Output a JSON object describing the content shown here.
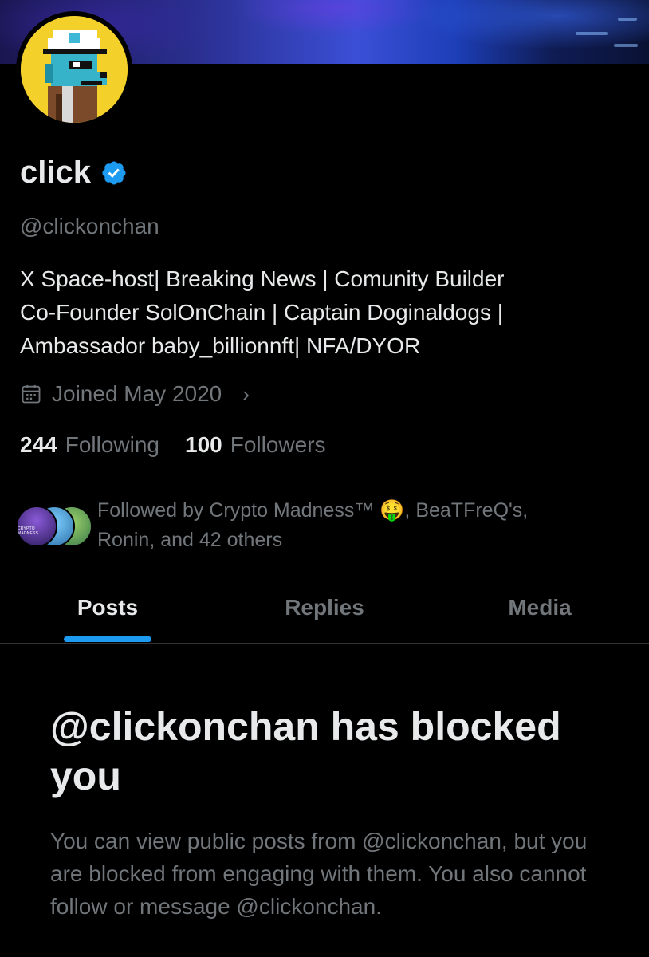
{
  "profile": {
    "display_name": "click",
    "handle": "@clickonchan",
    "bio_lines": [
      "X Space-host| Breaking News | Comunity Builder",
      "Co-Founder SolOnChain | Captain Doginaldogs |",
      "Ambassador baby_billionnft| NFA/DYOR"
    ],
    "joined": "Joined May 2020",
    "following_count": "244",
    "following_label": "Following",
    "followers_count": "100",
    "followers_label": "Followers",
    "followed_by_line1": "Followed by Crypto Madness™ 🤑, BeaTFreQ's,",
    "followed_by_line2": "Ronin, and 42 others",
    "followed_avatar_caption": "CRYPTO MADNESS"
  },
  "tabs": [
    {
      "label": "Posts",
      "active": true
    },
    {
      "label": "Replies",
      "active": false
    },
    {
      "label": "Media",
      "active": false
    }
  ],
  "blocked": {
    "title": "@clickonchan has blocked you",
    "body": "You can view public posts from @clickonchan, but you are blocked from engaging with them. You also cannot follow or message @clickonchan."
  },
  "colors": {
    "accent": "#1d9bf0",
    "background": "#000000",
    "text_primary": "#e7e9ea",
    "text_secondary": "#71767b",
    "avatar_bg": "#f4d02a"
  },
  "icons": [
    "verified-badge-icon",
    "calendar-icon",
    "chevron-right-icon"
  ]
}
